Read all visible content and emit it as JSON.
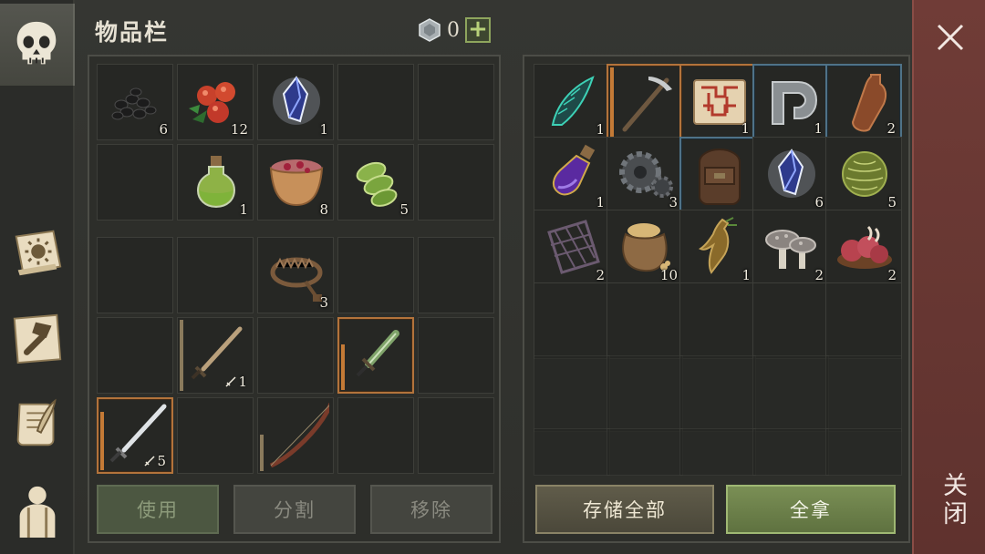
{
  "header": {
    "title": "物品栏",
    "currency_icon": "silver-coin-icon",
    "currency_count": "0",
    "add_label": "+"
  },
  "sidebar": {
    "items": [
      {
        "name": "skull",
        "active": true
      },
      {
        "name": "survival-book"
      },
      {
        "name": "crafting"
      },
      {
        "name": "quests-scroll"
      },
      {
        "name": "character"
      }
    ]
  },
  "inventory": {
    "row1": [
      {
        "item": "coal-icon",
        "qty": "6"
      },
      {
        "item": "berries-icon",
        "qty": "12"
      },
      {
        "item": "crystal-icon",
        "qty": "1"
      }
    ],
    "row2": [
      {
        "item": "potion-icon",
        "qty": "1"
      },
      {
        "item": "berry-bowl-icon",
        "qty": "8"
      },
      {
        "item": "cactus-slices-icon",
        "qty": "5"
      }
    ],
    "trap": {
      "item": "bear-trap-icon",
      "qty": "3"
    },
    "sword1_qty": "1",
    "sword2_qty": "5"
  },
  "chest": {
    "row1": [
      {
        "item": "horn-icon",
        "qty": "1"
      },
      {
        "item": "pickaxe-icon",
        "qty": ""
      },
      {
        "item": "map-icon",
        "qty": "1"
      },
      {
        "item": "metal-hook-icon",
        "qty": "1"
      },
      {
        "item": "leather-icon",
        "qty": "2"
      }
    ],
    "row2": [
      {
        "item": "purple-potion-icon",
        "qty": "1"
      },
      {
        "item": "gear-icon",
        "qty": "3"
      },
      {
        "item": "backpack-icon",
        "qty": ""
      },
      {
        "item": "crystal-icon",
        "qty": "6"
      },
      {
        "item": "herb-ball-icon",
        "qty": "5"
      }
    ],
    "row3": [
      {
        "item": "grate-icon",
        "qty": "2"
      },
      {
        "item": "sack-icon",
        "qty": "10"
      },
      {
        "item": "root-icon",
        "qty": "1"
      },
      {
        "item": "mushrooms-icon",
        "qty": "2"
      },
      {
        "item": "meat-icon",
        "qty": "2"
      }
    ]
  },
  "buttons": {
    "use": "使用",
    "split": "分割",
    "remove": "移除",
    "store_all": "存储全部",
    "take_all": "全拿"
  },
  "close": {
    "label": "关闭"
  }
}
